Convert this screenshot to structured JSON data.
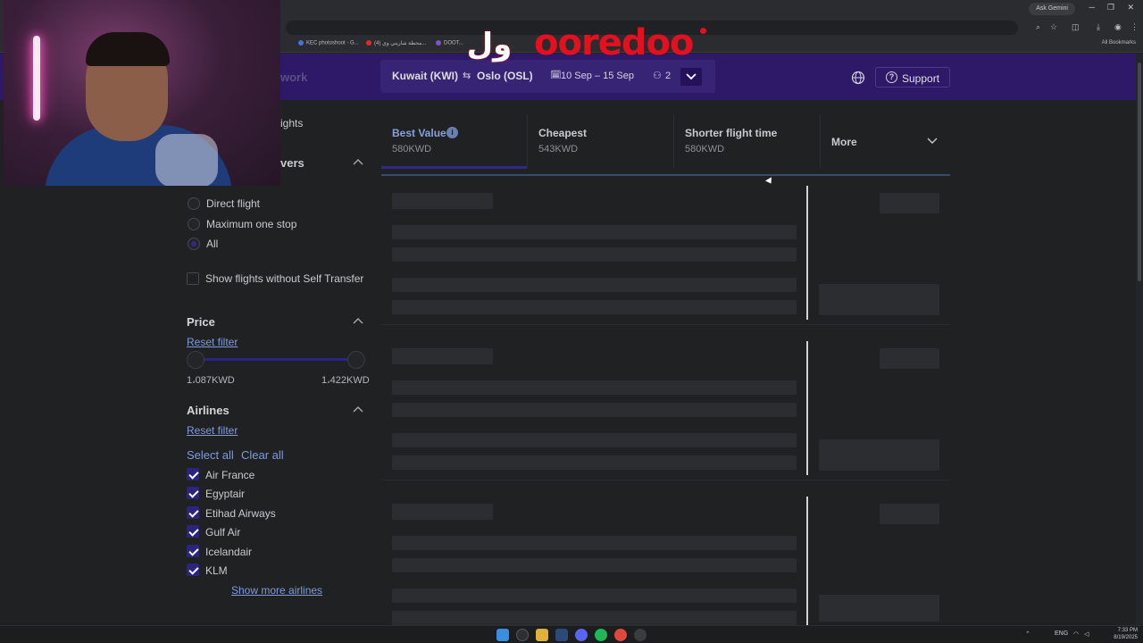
{
  "browser": {
    "gemini_label": "Ask Gemini",
    "bookmarks": [
      {
        "label": "KEC photoshoot - G...",
        "color": "#3d74e0"
      },
      {
        "label": "(4) محطة شاريني وي...",
        "color": "#e02a2a"
      },
      {
        "label": "DOOT...",
        "color": "#7a55c4"
      }
    ],
    "all_bookmarks": "All Bookmarks"
  },
  "overlay": {
    "ooredoo": "ooredoo",
    "ooredoo_ar": "ول"
  },
  "header": {
    "brand_partial": "work",
    "from": "Kuwait (KWI)",
    "to": "Oslo (OSL)",
    "dates": "10 Sep – 15 Sep",
    "passengers": "2",
    "support": "Support"
  },
  "filters": {
    "partial_top": "ights",
    "partial_stopovers": "vers",
    "stops": [
      {
        "label": "Direct flight",
        "selected": false
      },
      {
        "label": "Maximum one stop",
        "selected": false
      },
      {
        "label": "All",
        "selected": true
      }
    ],
    "self_transfer": "Show flights without Self Transfer",
    "price": {
      "title": "Price",
      "reset": "Reset filter",
      "min": "1،087KWD",
      "max": "1،422KWD",
      "min_fraction": 0,
      "max_fraction": 1
    },
    "airlines": {
      "title": "Airlines",
      "reset": "Reset filter",
      "select_all": "Select all",
      "clear_all": "Clear all",
      "items": [
        "Air France",
        "Egyptair",
        "Etihad Airways",
        "Gulf Air",
        "Icelandair",
        "KLM"
      ],
      "show_more": "Show more airlines"
    }
  },
  "sort_tabs": [
    {
      "label": "Best Value",
      "price": "580KWD",
      "active": true
    },
    {
      "label": "Cheapest",
      "price": "543KWD",
      "active": false
    },
    {
      "label": "Shorter flight time",
      "price": "580KWD",
      "active": false
    },
    {
      "label": "More",
      "price": "",
      "active": false
    }
  ],
  "taskbar": {
    "lang": "ENG",
    "time": "7:33 PM",
    "date": "8/19/2025"
  }
}
